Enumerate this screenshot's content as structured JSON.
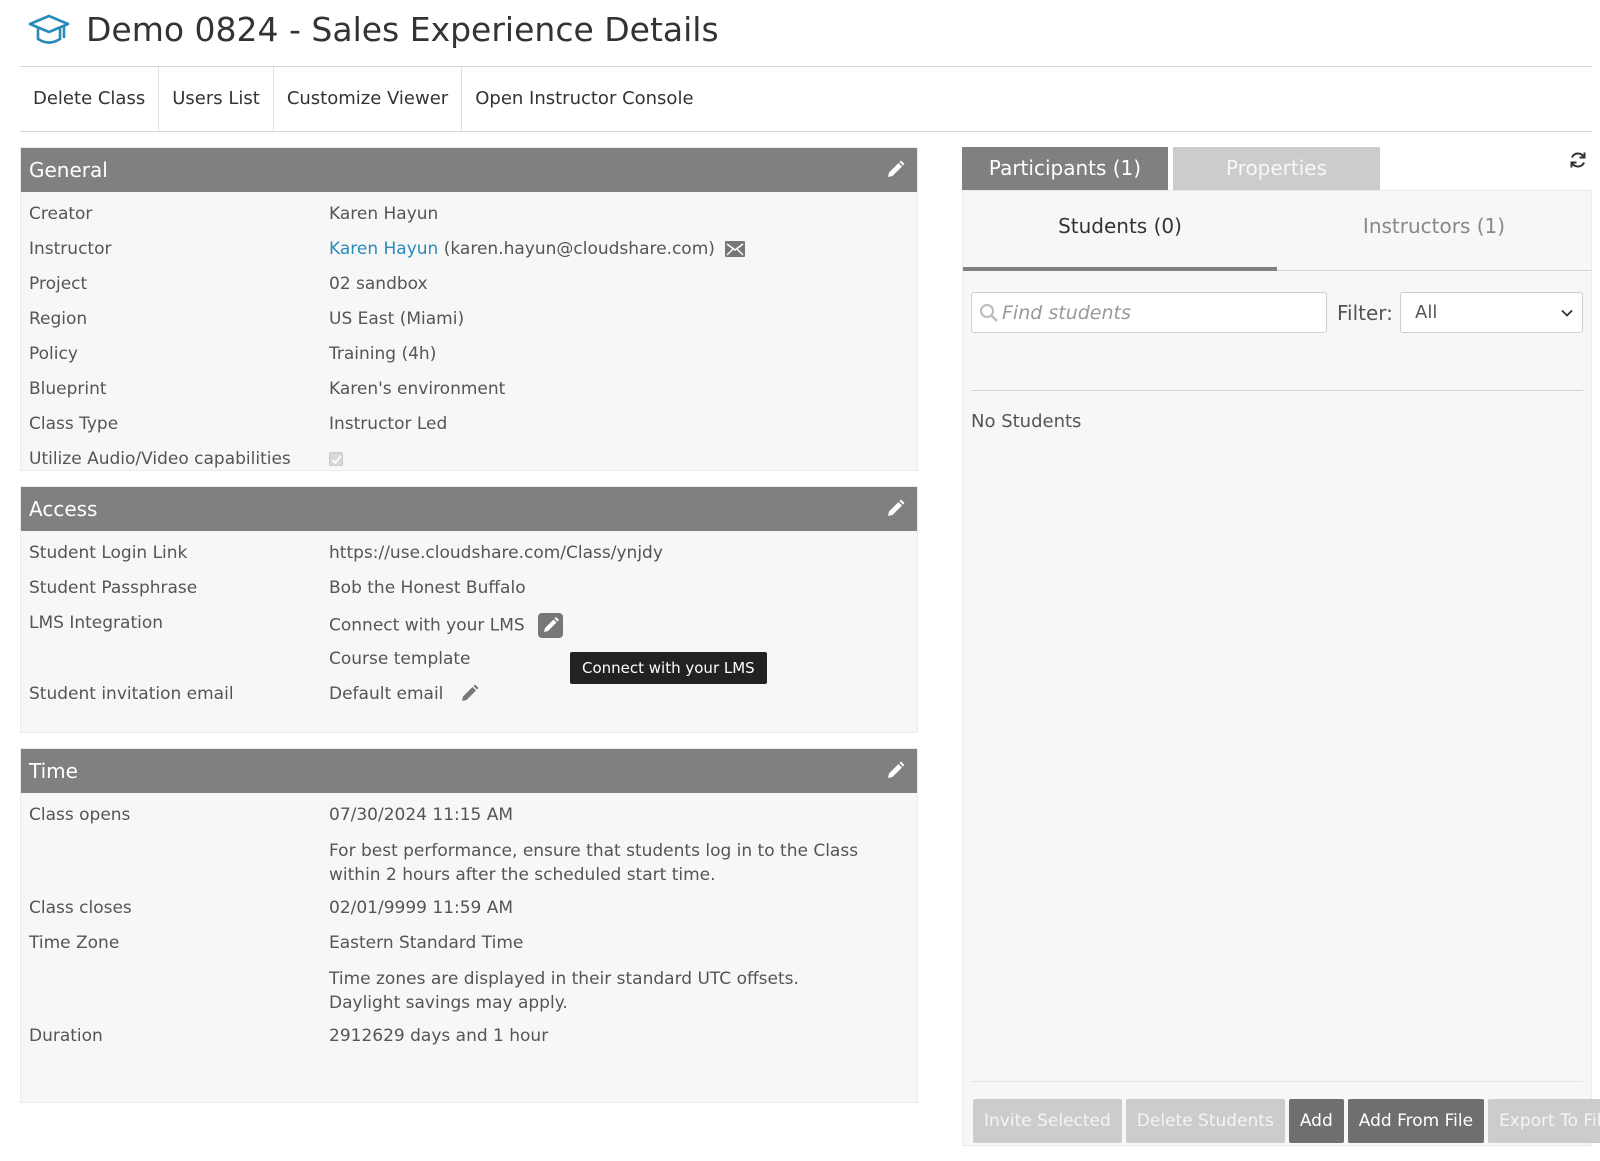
{
  "header": {
    "title": "Demo 0824 - Sales Experience Details",
    "icon": "graduation-cap-icon"
  },
  "toolbar": {
    "delete_class": "Delete Class",
    "users_list": "Users List",
    "customize_viewer": "Customize Viewer",
    "open_instructor_console": "Open Instructor Console"
  },
  "general": {
    "title": "General",
    "creator": {
      "label": "Creator",
      "value": "Karen Hayun"
    },
    "instructor": {
      "label": "Instructor",
      "name": "Karen Hayun",
      "email": "(karen.hayun@cloudshare.com)"
    },
    "project": {
      "label": "Project",
      "value": "02 sandbox"
    },
    "region": {
      "label": "Region",
      "value": "US East (Miami)"
    },
    "policy": {
      "label": "Policy",
      "value": "Training (4h)"
    },
    "blueprint": {
      "label": "Blueprint",
      "value": "Karen's environment"
    },
    "class_type": {
      "label": "Class Type",
      "value": "Instructor Led"
    },
    "av": {
      "label": "Utilize Audio/Video capabilities",
      "checked": true
    }
  },
  "access": {
    "title": "Access",
    "login_link": {
      "label": "Student Login Link",
      "value": "https://use.cloudshare.com/Class/ynjdy"
    },
    "passphrase": {
      "label": "Student Passphrase",
      "value": "Bob the Honest Buffalo"
    },
    "lms": {
      "label": "LMS Integration",
      "value": "Connect with your LMS",
      "course_template": "Course template",
      "tooltip": "Connect with your LMS"
    },
    "invitation_email": {
      "label": "Student invitation email",
      "value": "Default email"
    }
  },
  "time": {
    "title": "Time",
    "opens": {
      "label": "Class opens",
      "value": "07/30/2024 11:15 AM",
      "note": "For best performance, ensure that students log in to the Class within 2 hours after the scheduled start time."
    },
    "closes": {
      "label": "Class closes",
      "value": "02/01/9999 11:59 AM"
    },
    "timezone": {
      "label": "Time Zone",
      "value": "Eastern Standard Time",
      "note": "Time zones are displayed in their standard UTC offsets. Daylight savings may apply."
    },
    "duration": {
      "label": "Duration",
      "value": "2912629 days and 1 hour"
    }
  },
  "right": {
    "tabs": {
      "participants": "Participants (1)",
      "properties": "Properties"
    },
    "subtabs": {
      "students": "Students (0)",
      "instructors": "Instructors (1)"
    },
    "search_placeholder": "Find students",
    "filter_label": "Filter:",
    "filter_value": "All",
    "empty": "No Students",
    "buttons": {
      "invite_selected": "Invite Selected",
      "delete_students": "Delete Students",
      "add": "Add",
      "add_from_file": "Add From File",
      "export_to_file": "Export To File"
    }
  },
  "colors": {
    "accent_link": "#2a8ab9",
    "header_gray": "#808080",
    "panel_bg": "#f7f7f7"
  }
}
